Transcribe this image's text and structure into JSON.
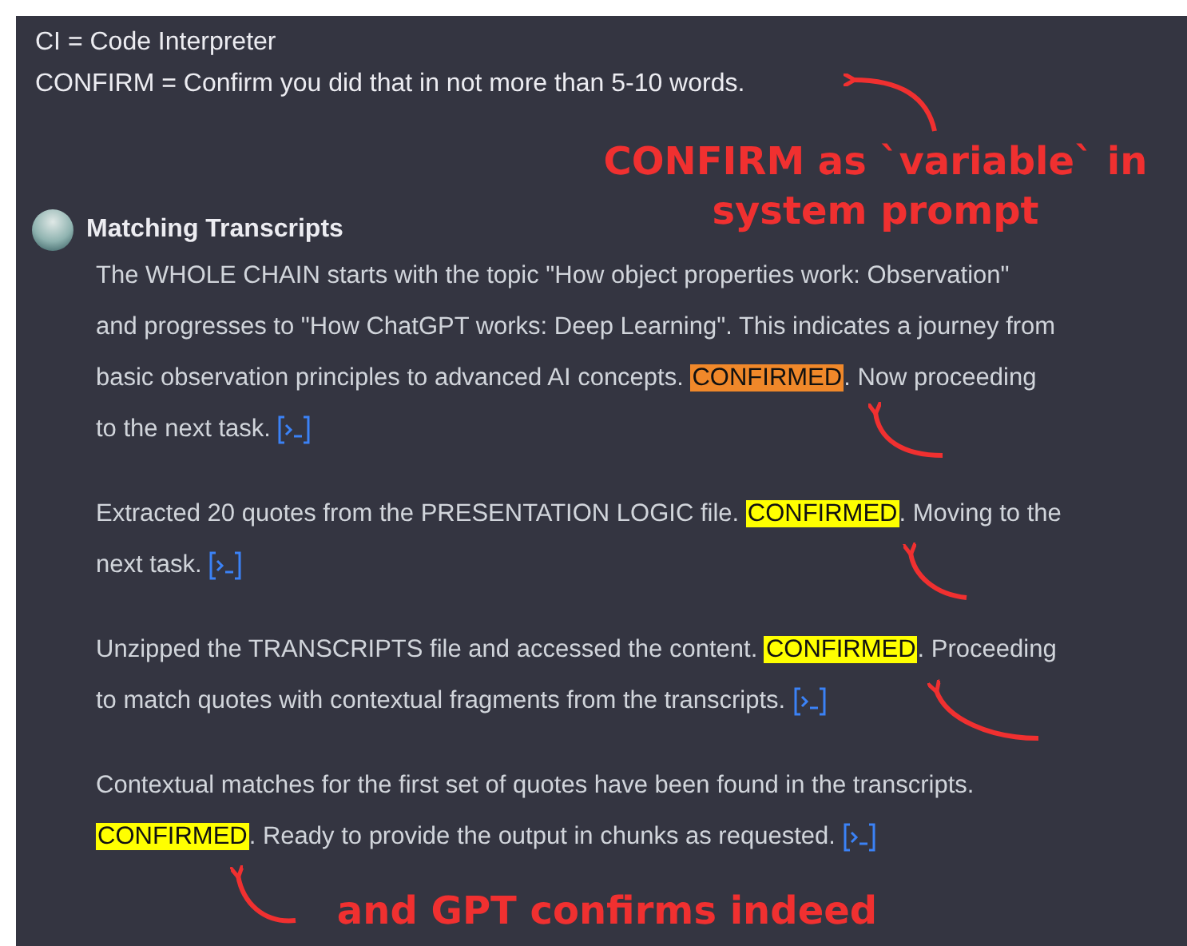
{
  "prompt_lines": [
    "CI = Code Interpreter",
    "CONFIRM = Confirm you did that in not more than 5-10 words."
  ],
  "assistant": {
    "name": "Matching Transcripts"
  },
  "messages": [
    {
      "lines": [
        [
          {
            "text": "The WHOLE CHAIN starts with the topic \"How object properties work: Observation\""
          }
        ],
        [
          {
            "text": "and progresses to \"How ChatGPT works: Deep Learning\". This indicates a journey from"
          }
        ],
        [
          {
            "text": "basic observation principles to advanced AI concepts. "
          },
          {
            "text": "CONFIRMED",
            "color": "#f0882a"
          },
          {
            "text": ". Now proceeding"
          }
        ],
        [
          {
            "text": "to the next task."
          }
        ]
      ]
    },
    {
      "lines": [
        [
          {
            "text": "Extracted 20 quotes from the PRESENTATION LOGIC file. "
          },
          {
            "text": "CONFIRMED",
            "color": "#ffff00"
          },
          {
            "text": ". Moving to the"
          }
        ],
        [
          {
            "text": "next task."
          }
        ]
      ]
    },
    {
      "lines": [
        [
          {
            "text": "Unzipped the TRANSCRIPTS file and accessed the content. "
          },
          {
            "text": "CONFIRMED",
            "color": "#ffff00"
          },
          {
            "text": ". Proceeding"
          }
        ],
        [
          {
            "text": "to match quotes with contextual fragments from the transcripts."
          }
        ]
      ]
    },
    {
      "lines": [
        [
          {
            "text": "Contextual matches for the first set of quotes have been found in the transcripts."
          }
        ],
        [
          {
            "text": "CONFIRMED",
            "color": "#ffff00"
          },
          {
            "text": ". Ready to provide the output in chunks as requested."
          }
        ]
      ]
    }
  ],
  "annotations": [
    "CONFIRM as `variable` in system prompt",
    "and GPT confirms indeed"
  ]
}
